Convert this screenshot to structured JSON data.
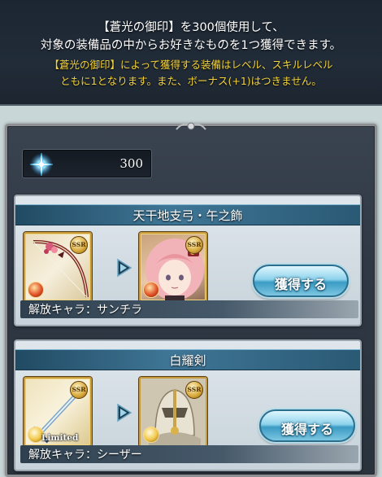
{
  "notice": {
    "line1": "【蒼光の御印】を300個使用して、",
    "line2": "対象の装備品の中からお好きなものを1つ獲得できます。",
    "note1": "【蒼光の御印】によって獲得する装備はレベル、スキルレベル",
    "note2": "ともに1となります。また、ボーナス(+1)はつきません。"
  },
  "currency": {
    "icon": "blue-crystal-seal-icon",
    "value": "300"
  },
  "items": [
    {
      "name": "天干地支弓・午之飾",
      "rarity": "SSR",
      "weapon_icon": "bow-icon",
      "element": "fire",
      "character_rarity": "SSR",
      "character_element": "fire",
      "unlock": "解放キャラ：サンチラ",
      "button": "獲得する"
    },
    {
      "name": "白耀剣",
      "rarity": "SSR",
      "weapon_icon": "sword-icon",
      "element": "light",
      "limited": "Limited",
      "character_rarity": "SSR",
      "character_element": "light",
      "unlock": "解放キャラ：シーザー",
      "button": "獲得する"
    }
  ],
  "colors": {
    "banner_bg": "#1f2935",
    "notice_gold": "#f3d23c",
    "title_bar": "#3f7696",
    "button_blue": "#3b9cc4",
    "frame_gold": "#c49a3c"
  }
}
